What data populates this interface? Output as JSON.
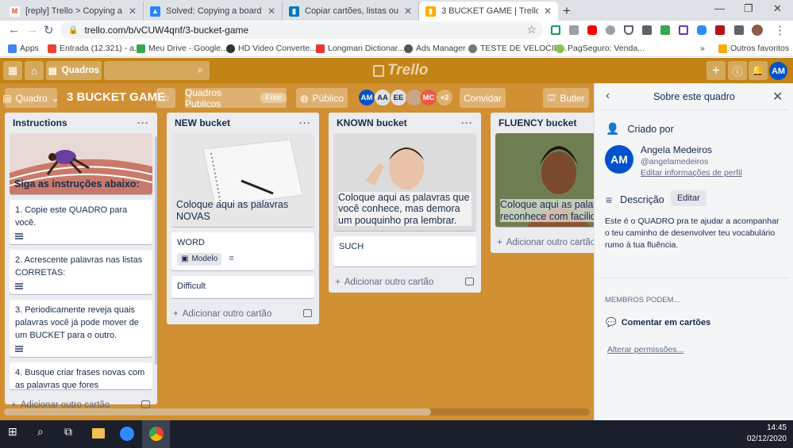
{
  "browser": {
    "tabs": [
      {
        "title": "[reply] Trello > Copying a board",
        "icon": "gmail-icon",
        "color": "#ea4335"
      },
      {
        "title": "Solved: Copying a board",
        "icon": "atlassian-icon",
        "color": "#2684ff"
      },
      {
        "title": "Copiar cartões, listas ou quadros",
        "icon": "trello-icon",
        "color": "#0079bf"
      },
      {
        "title": "3 BUCKET GAME | Trello",
        "icon": "trello-icon",
        "color": "#ffab00"
      }
    ],
    "url": "trello.com/b/vCUW4qnf/3-bucket-game",
    "bookmarks": [
      {
        "label": "Apps",
        "color": "#4285f4"
      },
      {
        "label": "Entrada (12.321) - a...",
        "color": "#ea4335"
      },
      {
        "label": "Meu Drive - Google...",
        "color": "#34a853"
      },
      {
        "label": "HD Video Converte...",
        "color": "#333333"
      },
      {
        "label": "Longman Dictionar...",
        "color": "#e53935"
      },
      {
        "label": "Ads Manager",
        "color": "#555555"
      },
      {
        "label": "TESTE DE VELOCID...",
        "color": "#777777"
      },
      {
        "label": "PagSeguro: Venda...",
        "color": "#8bc34a"
      }
    ],
    "bookmarks_more": "»",
    "other_bookmarks": "Outros favoritos"
  },
  "header": {
    "boards_label": "Quadros",
    "logo_text": "Trello",
    "avatar_initials": "AM",
    "accent": "#c38417"
  },
  "board": {
    "menu_label": "Quadro",
    "title": "3 BUCKET GAME",
    "team_label": "Quadros Publicos",
    "free_label": "Free",
    "visibility_label": "Público",
    "members": [
      {
        "initials": "AM",
        "color": "#0052cc"
      },
      {
        "initials": "AA",
        "color": "#dfe1e6"
      },
      {
        "initials": "EE",
        "color": "#dfe1e6"
      },
      {
        "initials": "",
        "color": "#c9a68a"
      },
      {
        "initials": "MC",
        "color": "#eb5a46"
      }
    ],
    "members_more": "+2",
    "invite_label": "Convidar",
    "butler_label": "Butler",
    "background": "#d29034"
  },
  "lists": [
    {
      "title": "Instructions",
      "cover_text": "Siga as instruções abaixo:",
      "cards": [
        "1. Copie este QUADRO para você.",
        "2. Acrescente palavras nas listas CORRETAS:",
        "3. Periodicamente reveja quais palavras você já pode mover de um BUCKET para o outro.",
        "4. Busque criar frases novas com as palavras que fores trabalhando."
      ],
      "add_label": "Adicionar outro cartão"
    },
    {
      "title": "NEW bucket",
      "cover_text": "Coloque aqui as palavras NOVAS",
      "cards": [
        "WORD",
        "Difficult"
      ],
      "template_badge": "Modelo",
      "add_label": "Adicionar outro cartão"
    },
    {
      "title": "KNOWN bucket",
      "cover_text": "Coloque aqui as palavras que você conhece, mas demora um pouquinho pra lembrar.",
      "cards": [
        "SUCH"
      ],
      "add_label": "Adicionar outro cartão"
    },
    {
      "title": "FLUENCY bucket",
      "cover_text": "Coloque aqui as palavras que você reconhece com facilidade",
      "cards": [],
      "add_label": "Adicionar outro cartão"
    }
  ],
  "panel": {
    "title": "Sobre este quadro",
    "created_by_label": "Criado por",
    "creator_initials": "AM",
    "creator_name": "Angela Medeiros",
    "creator_handle": "@angelamedeiros",
    "edit_profile_link": "Editar informações de perfil",
    "description_label": "Descrição",
    "edit_label": "Editar",
    "description_text": "Este é o QUADRO pra te ajudar a acompanhar o teu caminho de desenvolver teu vocabulário rumo à tua fluência.",
    "members_can_label": "MEMBROS PODEM...",
    "comment_label": "Comentar em cartões",
    "change_permissions_link": "Alterar permissões..."
  },
  "taskbar": {
    "time": "14:45",
    "date": "02/12/2020"
  }
}
